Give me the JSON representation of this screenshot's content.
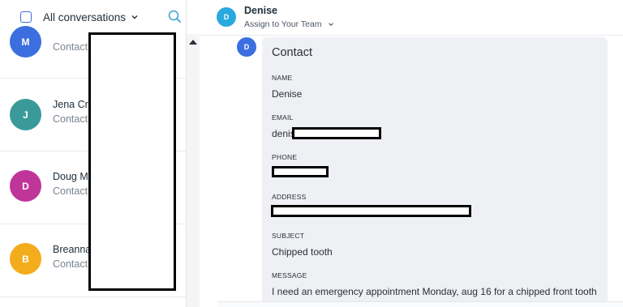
{
  "list": {
    "header_title": "All conversations",
    "conversations": [
      {
        "initial": "M",
        "name": "",
        "subtitle": "Contact",
        "color": "#3b6fe0"
      },
      {
        "initial": "J",
        "name": "Jena Cre",
        "subtitle": "Contact",
        "color": "#3a9a9a"
      },
      {
        "initial": "D",
        "name": "Doug Mc",
        "subtitle": "Contact",
        "color": "#c0359a"
      },
      {
        "initial": "B",
        "name": "Breanna",
        "subtitle": "Contact",
        "color": "#f3ac1c"
      }
    ]
  },
  "conversation": {
    "initial": "D",
    "name": "Denise",
    "assign_label": "Assign to Your Team",
    "message_avatar_initial": "D"
  },
  "contact_card": {
    "title": "Contact",
    "name_label": "NAME",
    "name_value": "Denise",
    "email_label": "EMAIL",
    "email_value_visible": "denis",
    "phone_label": "PHONE",
    "address_label": "ADDRESS",
    "subject_label": "SUBJECT",
    "subject_value": "Chipped tooth",
    "message_label": "MESSAGE",
    "message_value": "I need an emergency appointment Monday, aug 16 for a chipped front tooth"
  },
  "icons": {
    "select_all": "checkbox-icon",
    "filter_dropdown": "chevron-down-icon",
    "search": "search-icon",
    "scroll_up": "arrow-up-icon"
  },
  "colors": {
    "accent": "#3b6fe0",
    "header_avatar": "#2aa8e0",
    "card_background": "#eef0f4"
  }
}
